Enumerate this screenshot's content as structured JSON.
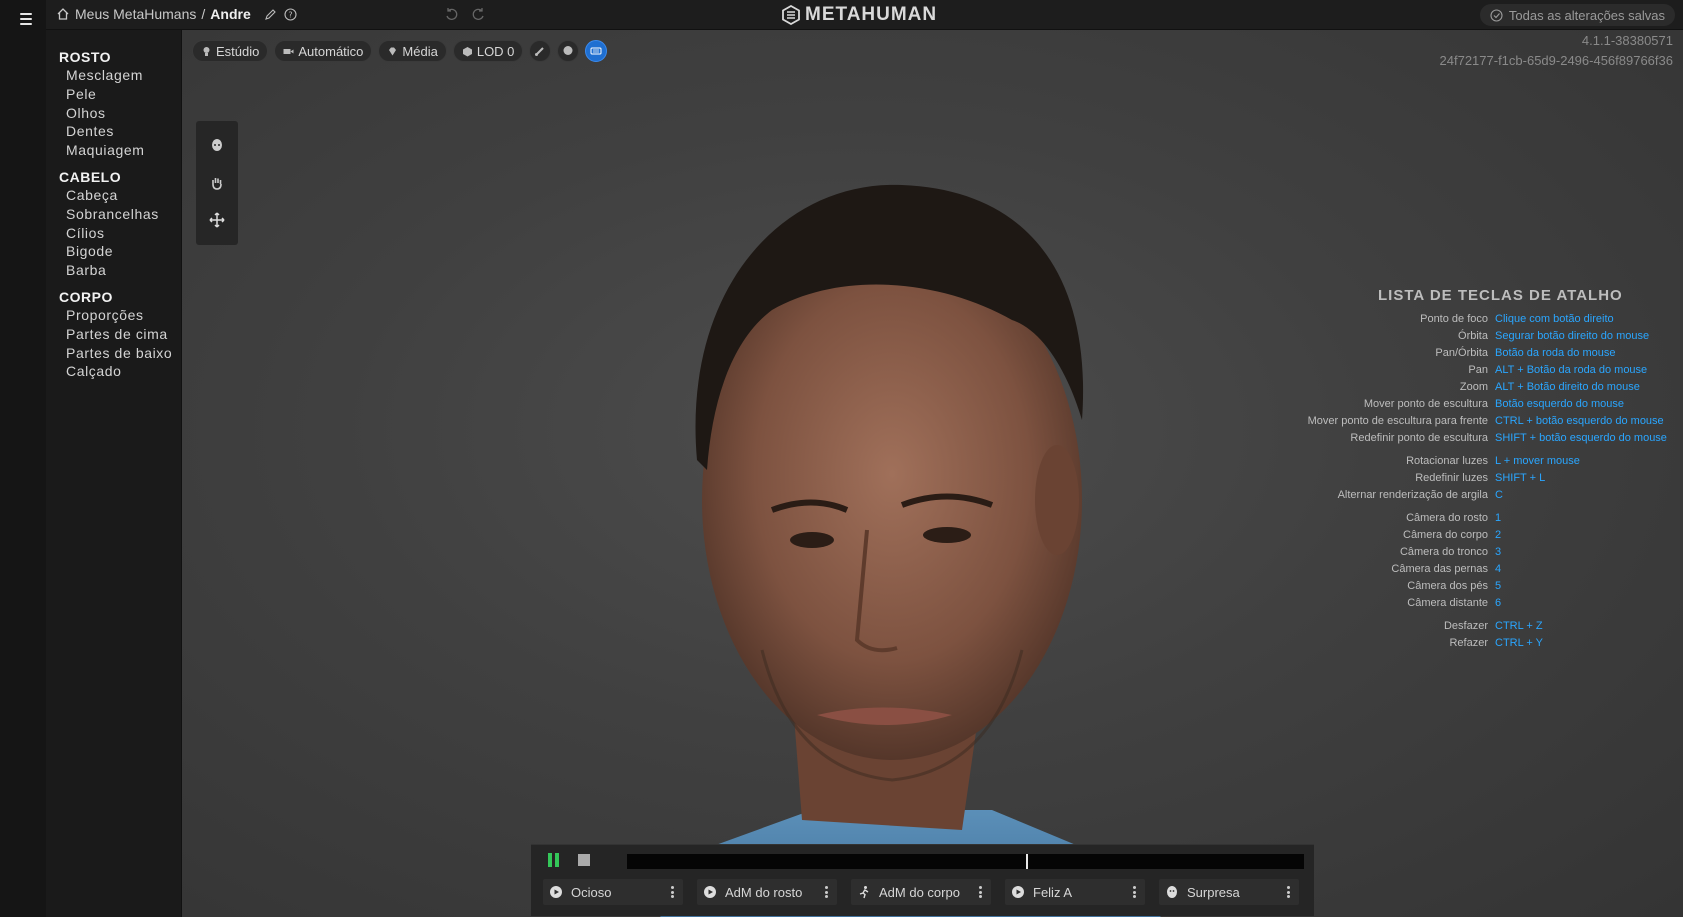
{
  "header": {
    "breadcrumb_root": "Meus MetaHumans",
    "breadcrumb_sep": "/",
    "breadcrumb_current": "Andre",
    "logo_text": "METAHUMAN",
    "saved_status": "Todas as alterações salvas"
  },
  "sidebar": {
    "sections": [
      {
        "title": "ROSTO",
        "items": [
          "Mesclagem",
          "Pele",
          "Olhos",
          "Dentes",
          "Maquiagem"
        ]
      },
      {
        "title": "CABELO",
        "items": [
          "Cabeça",
          "Sobrancelhas",
          "Cílios",
          "Bigode",
          "Barba"
        ]
      },
      {
        "title": "CORPO",
        "items": [
          "Proporções",
          "Partes de cima",
          "Partes de baixo",
          "Calçado"
        ]
      }
    ]
  },
  "toolbar": {
    "lighting": "Estúdio",
    "camera": "Automático",
    "quality": "Média",
    "lod": "LOD 0"
  },
  "version": {
    "number": "4.1.1-38380571",
    "hash": "24f72177-f1cb-65d9-2496-456f89766f36"
  },
  "shortcuts": {
    "title": "LISTA DE TECLAS DE ATALHO",
    "groups": [
      [
        {
          "action": "Ponto de foco",
          "key": "Clique com botão direito"
        },
        {
          "action": "Órbita",
          "key": "Segurar botão direito do mouse"
        },
        {
          "action": "Pan/Órbita",
          "key": "Botão da roda do mouse"
        },
        {
          "action": "Pan",
          "key": "ALT + Botão da roda do mouse"
        },
        {
          "action": "Zoom",
          "key": "ALT + Botão direito do mouse"
        },
        {
          "action": "Mover ponto de escultura",
          "key": "Botão esquerdo do mouse"
        },
        {
          "action": "Mover ponto de escultura para frente",
          "key": "CTRL + botão esquerdo do mouse"
        },
        {
          "action": "Redefinir ponto de escultura",
          "key": "SHIFT + botão esquerdo do mouse"
        }
      ],
      [
        {
          "action": "Rotacionar luzes",
          "key": "L + mover mouse"
        },
        {
          "action": "Redefinir luzes",
          "key": "SHIFT + L"
        },
        {
          "action": "Alternar renderização de argila",
          "key": "C"
        }
      ],
      [
        {
          "action": "Câmera do rosto",
          "key": "1"
        },
        {
          "action": "Câmera do corpo",
          "key": "2"
        },
        {
          "action": "Câmera do tronco",
          "key": "3"
        },
        {
          "action": "Câmera das pernas",
          "key": "4"
        },
        {
          "action": "Câmera dos pés",
          "key": "5"
        },
        {
          "action": "Câmera distante",
          "key": "6"
        }
      ],
      [
        {
          "action": "Desfazer",
          "key": "CTRL + Z"
        },
        {
          "action": "Refazer",
          "key": "CTRL + Y"
        }
      ]
    ]
  },
  "playback": {
    "progress": 0.59,
    "animations": [
      {
        "label": "Ocioso",
        "icon": "play-circle-icon"
      },
      {
        "label": "AdM do rosto",
        "icon": "play-circle-icon"
      },
      {
        "label": "AdM do corpo",
        "icon": "running-figure-icon"
      },
      {
        "label": "Feliz A",
        "icon": "play-circle-icon"
      },
      {
        "label": "Surpresa",
        "icon": "face-icon"
      }
    ]
  },
  "colors": {
    "accent_blue": "#2aa6ff",
    "play_green": "#34c759",
    "active_button": "#1f6fd1"
  }
}
